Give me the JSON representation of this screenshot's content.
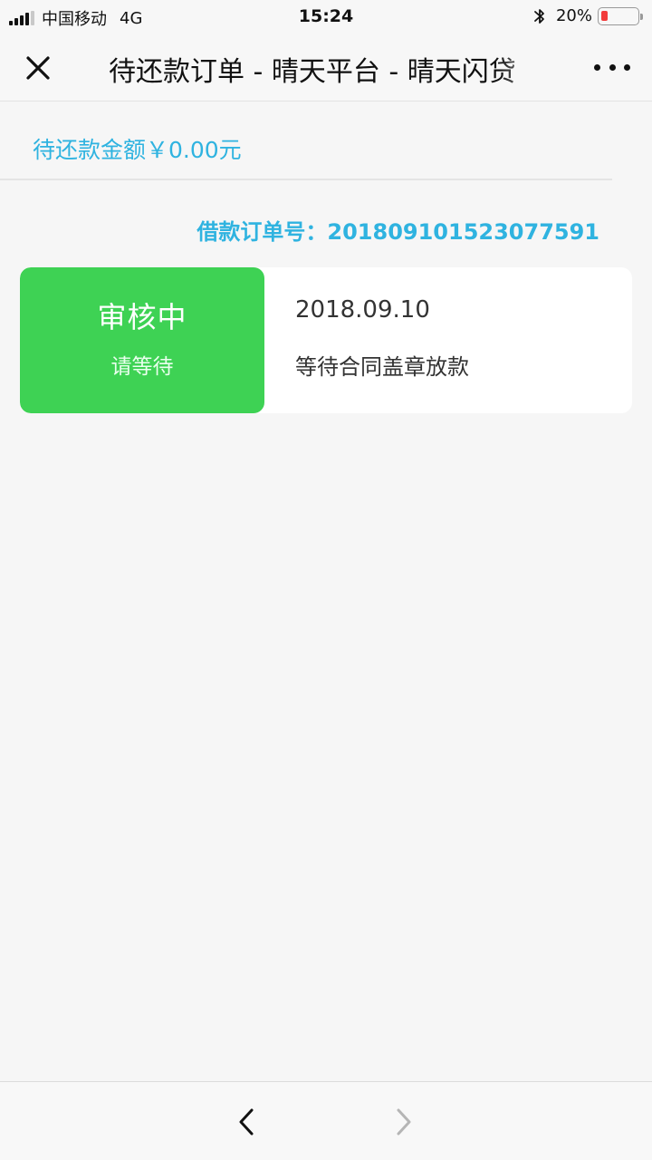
{
  "status_bar": {
    "carrier": "中国移动",
    "network": "4G",
    "time": "15:24",
    "battery_percent": "20%",
    "battery_level": 0.2,
    "icons": [
      "signal-icon",
      "bluetooth-icon",
      "battery-icon"
    ]
  },
  "nav": {
    "title": "待还款订单 - 晴天平台 - 晴天闪贷",
    "icons": [
      "close-icon",
      "more-icon"
    ]
  },
  "summary": {
    "text": "待还款金额￥0.00元"
  },
  "order": {
    "number_line": "借款订单号：201809101523077591",
    "status_title": "审核中",
    "status_sub": "请等待",
    "date": "2018.09.10",
    "description": "等待合同盖章放款"
  },
  "toolbar": {
    "icons": [
      "back-chevron-icon",
      "forward-chevron-icon"
    ]
  },
  "colors": {
    "accent_blue": "#2fb3e0",
    "status_green": "#3ed254",
    "battery_red": "#f23b3b",
    "background": "#f6f6f6"
  }
}
